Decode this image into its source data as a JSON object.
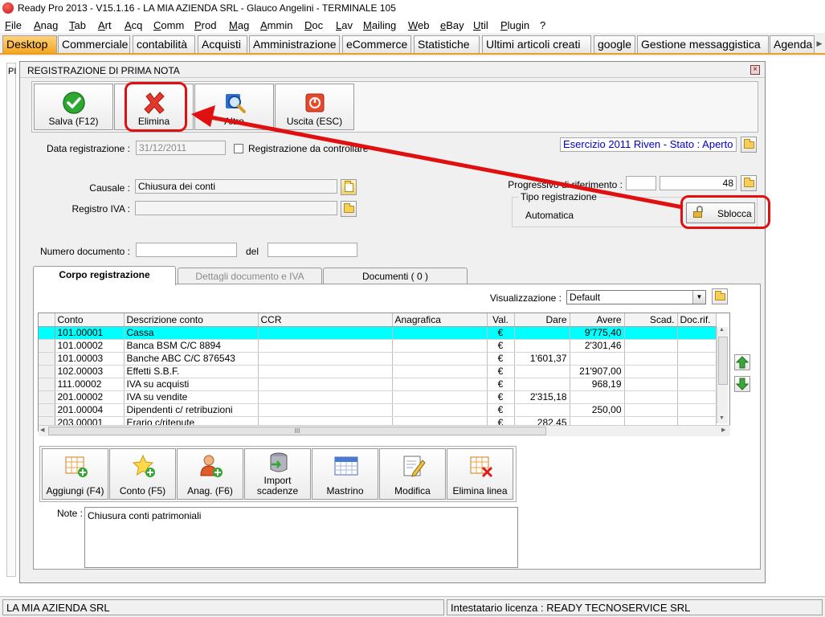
{
  "window": {
    "title": "Ready Pro 2013 - V15.1.16 - LA MIA AZIENDA SRL - Glauco Angelini - TERMINALE 105"
  },
  "menu": [
    {
      "label": "File",
      "u": "F",
      "rest": "ile"
    },
    {
      "label": "Anag",
      "u": "A",
      "rest": "nag"
    },
    {
      "label": "Tab",
      "u": "T",
      "rest": "ab"
    },
    {
      "label": "Art",
      "u": "A",
      "rest": "rt"
    },
    {
      "label": "Acq",
      "u": "A",
      "rest": "cq"
    },
    {
      "label": "Comm",
      "u": "C",
      "rest": "omm"
    },
    {
      "label": "Prod",
      "u": "P",
      "rest": "rod"
    },
    {
      "label": "Mag",
      "u": "M",
      "rest": "ag"
    },
    {
      "label": "Ammin",
      "u": "A",
      "rest": "mmin"
    },
    {
      "label": "Doc",
      "u": "D",
      "rest": "oc"
    },
    {
      "label": "Lav",
      "u": "L",
      "rest": "av"
    },
    {
      "label": "Mailing",
      "u": "M",
      "rest": "ailing"
    },
    {
      "label": "Web",
      "u": "W",
      "rest": "eb"
    },
    {
      "label": "eBay",
      "u": "e",
      "rest": "Bay"
    },
    {
      "label": "Util",
      "u": "U",
      "rest": "til"
    },
    {
      "label": "Plugin",
      "u": "P",
      "rest": "lugin"
    },
    {
      "label": "?",
      "u": "",
      "rest": "?"
    }
  ],
  "tabs": [
    "Desktop",
    "Commerciale",
    "contabilità",
    "Acquisti",
    "Amministrazione",
    "eCommerce",
    "Statistiche",
    "Ultimi articoli creati",
    "google",
    "Gestione messaggistica",
    "Agenda"
  ],
  "left_strip_text": "PI",
  "dialog": {
    "title": "REGISTRAZIONE DI PRIMA NOTA",
    "close": "×",
    "toolbar": {
      "save": "Salva (F12)",
      "delete": "Elimina",
      "other": "Altro",
      "exit": "Uscita (ESC)"
    },
    "data_registrazione_label": "Data registrazione :",
    "data_registrazione_value": "31/12/2011",
    "da_controllare_label": "Registrazione da controllare",
    "esercizio": "Esercizio 2011 Riven - Stato : Aperto",
    "causale_label": "Causale :",
    "causale_value": "Chiusura dei conti",
    "registro_iva_label": "Registro IVA :",
    "registro_iva_value": "",
    "progressivo_label": "Progressivo di riferimento :",
    "progressivo_value1": "",
    "progressivo_value2": "48",
    "tipo_registrazione_label": "Tipo registrazione",
    "tipo_registrazione_value": "Automatica",
    "sblocca": "Sblocca",
    "numero_documento_label": "Numero documento :",
    "numero_documento_value": "",
    "del_label": "del",
    "del_value": "",
    "inner_tabs": [
      "Corpo registrazione",
      "Dettagli documento e IVA",
      "Documenti ( 0 )"
    ],
    "visualizzazione_label": "Visualizzazione :",
    "visualizzazione_value": "Default",
    "grid": {
      "columns": [
        "Conto",
        "Descrizione conto",
        "CCR",
        "Anagrafica",
        "Val.",
        "Dare",
        "Avere",
        "Scad.",
        "Doc.rif."
      ],
      "rows": [
        [
          "101.00001",
          "Cassa",
          "",
          "",
          "€",
          "",
          "9'775,40",
          "",
          ""
        ],
        [
          "101.00002",
          "Banca BSM C/C 8894",
          "",
          "",
          "€",
          "",
          "2'301,46",
          "",
          ""
        ],
        [
          "101.00003",
          "Banche ABC C/C 876543",
          "",
          "",
          "€",
          "1'601,37",
          "",
          "",
          ""
        ],
        [
          "102.00003",
          "Effetti S.B.F.",
          "",
          "",
          "€",
          "",
          "21'907,00",
          "",
          ""
        ],
        [
          "111.00002",
          "IVA su acquisti",
          "",
          "",
          "€",
          "",
          "968,19",
          "",
          ""
        ],
        [
          "201.00002",
          "IVA su vendite",
          "",
          "",
          "€",
          "2'315,18",
          "",
          "",
          ""
        ],
        [
          "201.00004",
          "Dipendenti c/ retribuzioni",
          "",
          "",
          "€",
          "",
          "250,00",
          "",
          ""
        ],
        [
          "203.00001",
          "Erario c/ritenute",
          "",
          "",
          "€",
          "282,45",
          "",
          "",
          ""
        ]
      ],
      "hscroll_grip": "III"
    },
    "bottom_buttons": [
      {
        "line1": "Aggiungi (F4)",
        "line2": ""
      },
      {
        "line1": "Conto (F5)",
        "line2": ""
      },
      {
        "line1": "Anag. (F6)",
        "line2": ""
      },
      {
        "line1": "Import",
        "line2": "scadenze"
      },
      {
        "line1": "Mastrino",
        "line2": ""
      },
      {
        "line1": "Modifica",
        "line2": ""
      },
      {
        "line1": "Elimina linea",
        "line2": ""
      }
    ],
    "note_label": "Note :",
    "note_value": "Chiusura conti patrimoniali"
  },
  "status": {
    "company": "LA MIA AZIENDA SRL",
    "license": "Intestatario licenza : READY TECNOSERVICE SRL"
  },
  "colors": {
    "active_tab": "#f5a623",
    "selected_row": "#00ffff",
    "annotation": "#e01010",
    "esercizio_text": "#0000c0"
  }
}
